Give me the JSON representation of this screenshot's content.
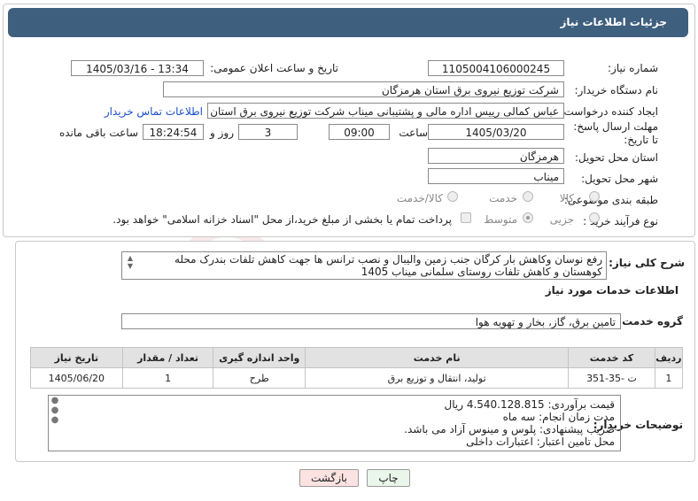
{
  "header": {
    "title": "جزئیات اطلاعات نیاز"
  },
  "fields": {
    "need_number_label": "شماره نیاز:",
    "need_number": "1105004106000245",
    "announce_label": "تاریخ و ساعت اعلان عمومی:",
    "announce_value": "1405/03/16 - 13:34",
    "buyer_org_label": "نام دستگاه خریدار:",
    "buyer_org": "شرکت توزیع نیروی برق استان هرمزگان",
    "creator_label": "ایجاد کننده درخواست:",
    "creator": "عباس کمالی رییس اداره مالی و پشتیبانی میناب شرکت توزیع نیروی برق استان",
    "contact_link": "اطلاعات تماس خریدار",
    "deadline_label": "مهلت ارسال پاسخ: تا تاریخ:",
    "deadline_date": "1405/03/20",
    "time_label": "ساعت",
    "deadline_time": "09:00",
    "days_value": "3",
    "days_label": "روز و",
    "remaining_time": "18:24:54",
    "remaining_label": "ساعت باقی مانده",
    "province_label": "استان محل تحویل:",
    "province": "هرمزگان",
    "city_label": "شهر محل تحویل:",
    "city": "میناب",
    "category_label": "طبقه بندی موضوعی:",
    "category_options": [
      "کالا",
      "خدمت",
      "کالا/خدمت"
    ],
    "process_label": "نوع فرآیند خرید :",
    "process_options": [
      "جزیی",
      "متوسط"
    ],
    "payment_note": "پرداخت تمام یا بخشی از مبلغ خرید،از محل \"اسناد خزانه اسلامی\" خواهد بود."
  },
  "summary": {
    "label": "شرح کلی نیاز:",
    "text": "رفع نوسان وکاهش بار کرگان جنب زمین والیبال و نصب ترانس ها جهت کاهش تلفات بندرک محله کوهستان و کاهش تلفات روستای سلمانی میناب 1405"
  },
  "services": {
    "section_title": "اطلاعات خدمات مورد نیاز",
    "group_label": "گروه خدمت:",
    "group_value": "تامین برق، گاز، بخار و تهویه هوا",
    "columns": [
      "ردیف",
      "کد خدمت",
      "نام خدمت",
      "واحد اندازه گیری",
      "تعداد / مقدار",
      "تاریخ نیاز"
    ],
    "rows": [
      {
        "index": "1",
        "code": "ت -35-351",
        "name": "تولید، انتقال و توزیع برق",
        "unit": "طرح",
        "qty": "1",
        "date": "1405/06/20"
      }
    ]
  },
  "buyer_notes": {
    "label": "توضیحات خریدار:",
    "lines": [
      "قیمت برآوردی: 4.540.128.815 ریال",
      "مدت زمان انجام: سه ماه",
      "ضریب پیشنهادی: پلوس  و مینوس آزاد می باشد.",
      "محل تامین اعتبار:  اعتبارات داخلی"
    ]
  },
  "buttons": {
    "print": "چاپ",
    "back": "بازگشت"
  },
  "colors": {
    "header_bg": "#3f5f7f",
    "link": "#1a4fc9",
    "watermark": "#c0392b"
  }
}
